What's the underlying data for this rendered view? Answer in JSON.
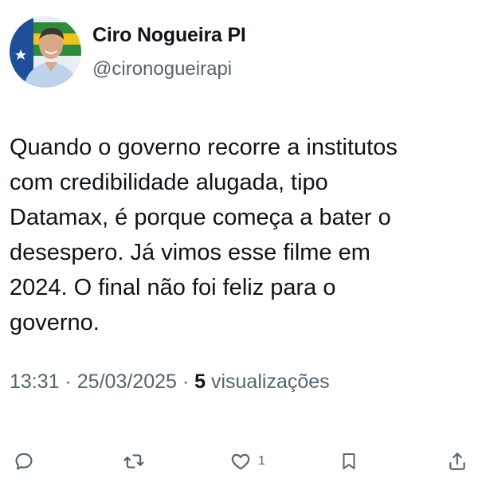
{
  "author": {
    "name": "Ciro Nogueira PI",
    "handle": "@cironogueirapi",
    "avatar_icon": "profile-photo-icon"
  },
  "tweet": {
    "text": "Quando o governo recorre a institutos\ncom credibilidade alugada, tipo\nDatamax, é porque começa a bater o\ndesespero. Já vimos esse filme em\n2024. O final não foi feliz para o\ngoverno."
  },
  "meta": {
    "time": "13:31",
    "separator": " · ",
    "date": "25/03/2025",
    "views_count": "5",
    "views_label": " visualizações"
  },
  "actions": {
    "reply_icon": "reply-icon",
    "retweet_icon": "retweet-icon",
    "like_icon": "heart-icon",
    "like_count": "1",
    "bookmark_icon": "bookmark-icon",
    "share_icon": "share-icon"
  },
  "colors": {
    "text_primary": "#0f1419",
    "text_secondary": "#536471",
    "background": "#ffffff"
  }
}
